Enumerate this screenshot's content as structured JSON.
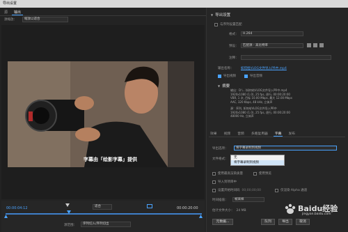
{
  "window": {
    "title": "导出设置"
  },
  "left": {
    "tabs": [
      "源",
      "输出"
    ],
    "source_range_label": "源缩放：",
    "source_range_value": "缩放以适合",
    "subtitle": "字幕由「绘影字幕」提供",
    "timecode_start": "00:00:04:12",
    "timecode_end": "00:00:20:00",
    "fit_value": "适合",
    "range_label": "源范围：",
    "range_value": "序列切入/序列切出"
  },
  "right": {
    "export_title": "导出设置",
    "match_sequence_label": "与序列设置匹配",
    "format_label": "格式：",
    "format_value": "H.264",
    "preset_label": "预设：",
    "preset_value": "匹配源 - 高比特率",
    "comment_label": "注释：",
    "output_label": "输出名称：",
    "output_value": "如何给VLOG文件导入PR中.mp4",
    "export_video_label": "导出视频",
    "export_audio_label": "导出音频",
    "summary_title": "摘要",
    "summary_output": "输出：D:\\...\\如何给VLOG文件导入PR中.mp4",
    "summary_line2": "1920x1080 (1.0), 25 fps, 逐行, 00:00:20:00",
    "summary_line3": "VBR, 1 次, 目标 10.00 Mbps, 最大 12.00 Mbps",
    "summary_line4": "AAC, 320 Kbps, 48 kHz, 立体声",
    "summary_source": "源：序列, 如何给VLOG文件导入PR中",
    "summary_line6": "1920x1080 (1.0), 25 fps, 逐行, 00:00:20:00",
    "summary_line7": "48000 Hz, 立体声"
  },
  "tabs_right": [
    "效果",
    "视频",
    "音频",
    "多路复用器",
    "字幕",
    "发布"
  ],
  "captions": {
    "export_option_label": "导出选项：",
    "export_option_value": "将字幕录制到视频",
    "file_format_label": "文件格式：",
    "menu_items": [
      "无",
      "将字幕录制到视频"
    ]
  },
  "options": {
    "max_render_label": "使用最高渲染质量",
    "use_preview_label": "使用预览",
    "import_project_label": "导入到项目中",
    "set_start_timecode_label": "设置开始时间码",
    "set_start_timecode_value": "00;00;00;00",
    "alpha_only_label": "仅渲染 Alpha 通道",
    "interpolation_label": "时间插值：",
    "interpolation_value": "帧采样",
    "estimated_size_label": "估计文件大小：",
    "estimated_size_value": "24 MB",
    "metadata_button": "元数据...",
    "queue_button": "队列",
    "export_button": "导出",
    "cancel_button": "取消"
  },
  "watermark": {
    "text": "Baidu经验",
    "sub": "jingyan.baidu.com"
  },
  "colors": {
    "accent": "#4aa3ff",
    "panel": "#262626",
    "bg": "#232323"
  }
}
